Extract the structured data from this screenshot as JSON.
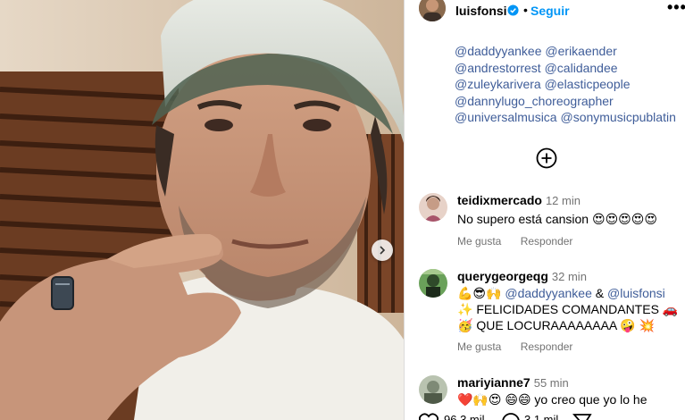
{
  "header": {
    "username": "luisfonsi",
    "separator": "•",
    "follow_label": "Seguir",
    "more_label": "•••"
  },
  "caption": {
    "mention_lines": [
      [
        "@daddyyankee",
        "@erikaender"
      ],
      [
        "@andrestorrest",
        "@calidandee"
      ],
      [
        "@zuleykarivera",
        "@elasticpeople"
      ],
      [
        "@dannylugo_choreographer"
      ],
      [
        "@universalmusica",
        "@sonymusicpublatin"
      ]
    ]
  },
  "comments": [
    {
      "user": "teidixmercado",
      "time": "12 min",
      "text_line1": "No supero está cansion 😍😍😍😍😍",
      "like_label": "Me gusta",
      "reply_label": "Responder"
    },
    {
      "user": "querygeorgeqg",
      "time": "32 min",
      "line1_prefix": "💪😎🙌",
      "line1_mention1": "@daddyyankee",
      "line1_amp": "&",
      "line1_mention2": "@luisfonsi",
      "line2": "✨ FELICIDADES COMANDANTES 🚗",
      "line3": "🥳 QUE LOCURAAAAAAAA 🤪 💥",
      "like_label": "Me gusta",
      "reply_label": "Responder"
    },
    {
      "user": "mariyianne7",
      "time": "55 min",
      "text_line1": "❤️🙌😍 😄😄 yo creo que yo lo he"
    }
  ],
  "footer": {
    "likes_partial": "96.3 mil",
    "comments_partial": "3.1 mil"
  },
  "colors": {
    "link": "#3f5d99",
    "follow": "#0095f6",
    "muted": "#737373",
    "verified": "#0095f6"
  }
}
